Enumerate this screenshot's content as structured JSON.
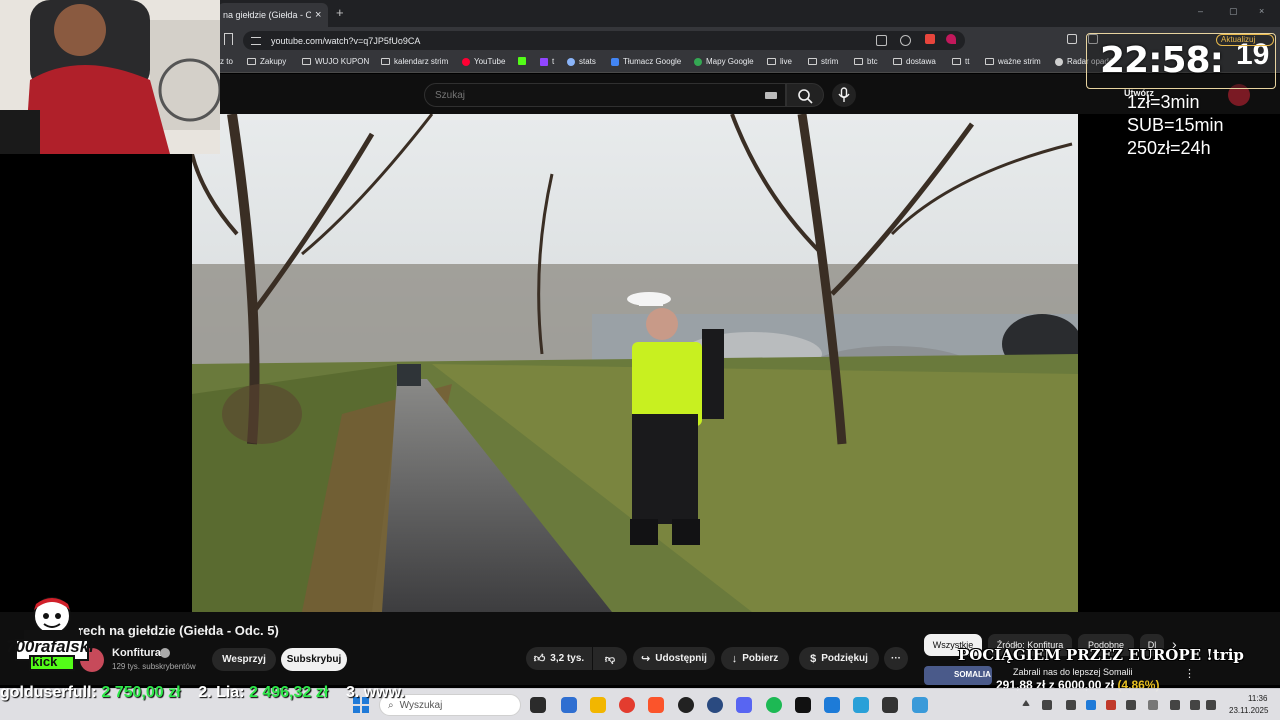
{
  "browser": {
    "tab_title": "na giełdzie (Giełda - Od",
    "tab_close": "×",
    "new_tab": "+",
    "url": "youtube.com/watch?v=q7JP5fUo9CA",
    "window_controls": [
      "–",
      "▢",
      "×"
    ]
  },
  "bookmarks": [
    {
      "label": "z to",
      "icon": "text"
    },
    {
      "label": "Zakupy",
      "icon": "folder-icon"
    },
    {
      "label": "WUJO KUPON",
      "icon": "folder-icon"
    },
    {
      "label": "kalendarz strim",
      "icon": "folder-icon"
    },
    {
      "label": "YouTube",
      "icon": "youtube-icon"
    },
    {
      "label": "",
      "icon": "kick-icon"
    },
    {
      "label": "t",
      "icon": "twitch-icon"
    },
    {
      "label": "stats",
      "icon": "stats-icon"
    },
    {
      "label": "Tłumacz Google",
      "icon": "translate-icon"
    },
    {
      "label": "Mapy Google",
      "icon": "maps-icon"
    },
    {
      "label": "live",
      "icon": "folder-icon"
    },
    {
      "label": "strim",
      "icon": "folder-icon"
    },
    {
      "label": "btc",
      "icon": "folder-icon"
    },
    {
      "label": "dostawa",
      "icon": "folder-icon"
    },
    {
      "label": "tt",
      "icon": "folder-icon"
    },
    {
      "label": "ważne strim",
      "icon": "folder-icon"
    },
    {
      "label": "Radar opadó",
      "icon": "radar-icon"
    }
  ],
  "youtube": {
    "search_placeholder": "Szukaj",
    "create_label": "Utwórz",
    "video_title": "rech na giełdzie (Giełda - Odc. 5)",
    "channel_name": "Konfitura",
    "subscriber_count": "129 tys. subskrybentów",
    "support_button": "Wesprzyj",
    "subscribe_button": "Subskrybuj",
    "like_count": "3,2 tys.",
    "share_button": "Udostępnij",
    "download_button": "Pobierz",
    "thanks_button": "Podziękuj",
    "more_button": "···",
    "chips": [
      "Wszystkie",
      "Źródło: Konfitura",
      "Podobne",
      "Dl"
    ],
    "chips_next": "›",
    "rec_title": "Zabrali nas do lepszej Somalii",
    "rec_thumb_text": "SOMALIA",
    "rec_menu": "⋮"
  },
  "overlay": {
    "timer": "22:58:",
    "timer_seconds": "19",
    "update_label": "Aktualizuj",
    "subathon_lines": [
      "1zł=3min",
      "SUB=15min",
      "250zł=24h"
    ],
    "tour_banner": "POCIĄGIEM PRZEZ EUROPE !trip",
    "goal_text": "291,88 zł z 6000,00 zł",
    "goal_percent": "(4,86%)",
    "kick_name": "700rafalski",
    "kick_tag": "kick",
    "leaderboard": [
      {
        "name": "golduserfull:",
        "amount": "2 750,00 zł"
      },
      {
        "name": "2. Lia:",
        "amount": "2 496,32 zł"
      },
      {
        "name": "3. www.",
        "amount": ""
      }
    ]
  },
  "taskbar": {
    "search_placeholder": "Wyszukaj",
    "time": "11:36",
    "date": "23.11.2025"
  },
  "colors": {
    "yt_bg": "#0f0f0f",
    "chip_active": "#f1f1f1",
    "leaderboard_amount": "#2ee84a",
    "goal_percent": "#e8c020",
    "timer_border": "#e8d4a0"
  }
}
